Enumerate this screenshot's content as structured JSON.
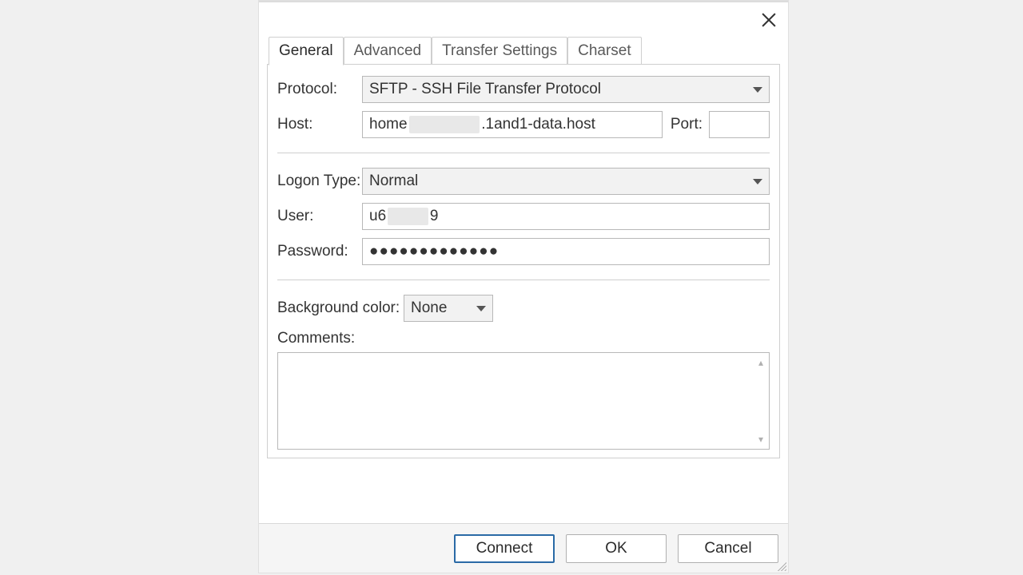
{
  "tabs": {
    "general": "General",
    "advanced": "Advanced",
    "transfer": "Transfer Settings",
    "charset": "Charset"
  },
  "labels": {
    "protocol": "Protocol:",
    "host": "Host:",
    "port": "Port:",
    "logon_type": "Logon Type:",
    "user": "User:",
    "password": "Password:",
    "bgcolor": "Background color:",
    "comments": "Comments:"
  },
  "values": {
    "protocol": "SFTP - SSH File Transfer Protocol",
    "host_prefix": "home",
    "host_suffix": ".1and1-data.host",
    "port": "",
    "logon_type": "Normal",
    "user_prefix": "u6",
    "user_suffix": "9",
    "password": "●●●●●●●●●●●●●",
    "bgcolor": "None",
    "comments": ""
  },
  "buttons": {
    "connect": "Connect",
    "ok": "OK",
    "cancel": "Cancel"
  }
}
